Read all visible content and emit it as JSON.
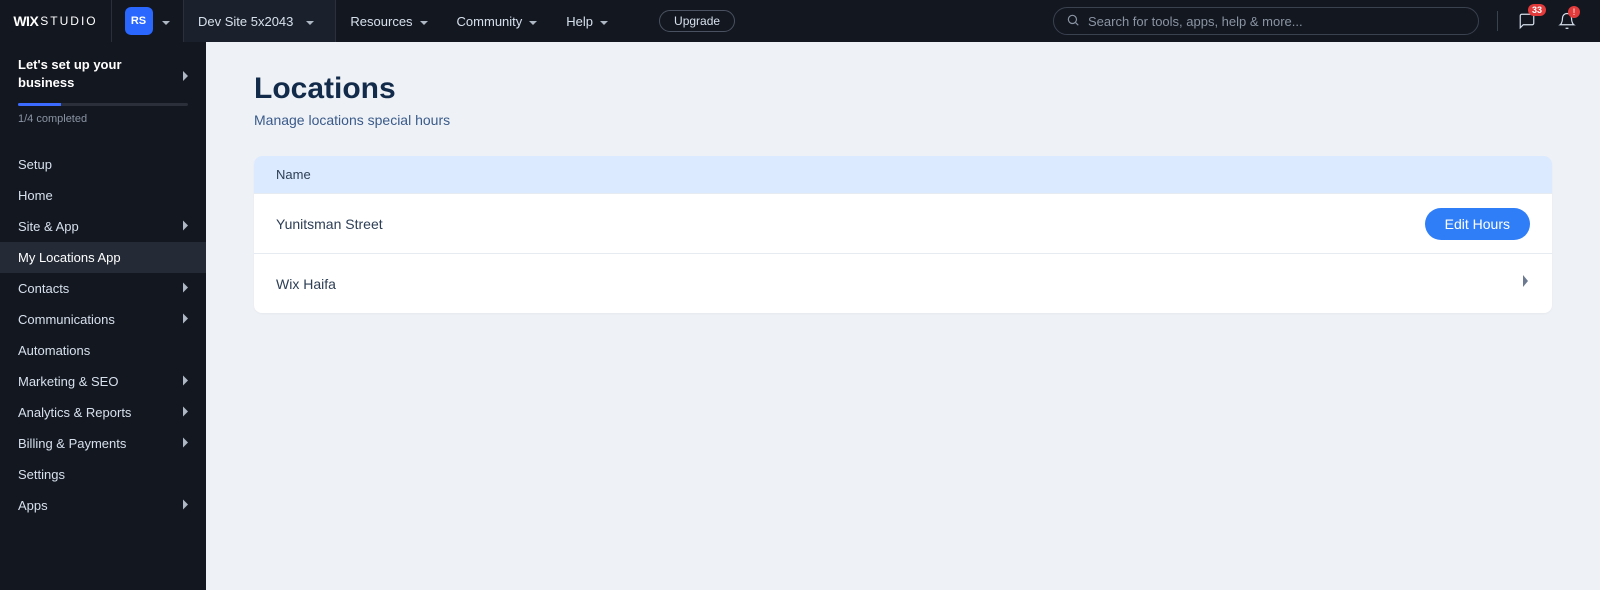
{
  "brand": {
    "wix": "WIX",
    "studio": "STUDIO"
  },
  "avatar": {
    "initials": "RS"
  },
  "site": {
    "name": "Dev Site 5x2043"
  },
  "topnav": {
    "resources": "Resources",
    "community": "Community",
    "help": "Help",
    "upgrade": "Upgrade"
  },
  "search": {
    "placeholder": "Search for tools, apps, help & more..."
  },
  "notifications": {
    "inbox_count": "33",
    "bell_alert": "!"
  },
  "setup": {
    "title_line1": "Let's set up your",
    "title_line2": "business",
    "progress_pct": 25,
    "progress_label": "1/4 completed"
  },
  "sidebar": {
    "setup_item": "Setup",
    "home": "Home",
    "site_app": "Site & App",
    "my_locations": "My Locations App",
    "contacts": "Contacts",
    "communications": "Communications",
    "automations": "Automations",
    "marketing": "Marketing & SEO",
    "analytics": "Analytics & Reports",
    "billing": "Billing & Payments",
    "settings": "Settings",
    "apps": "Apps"
  },
  "page": {
    "title": "Locations",
    "subtitle": "Manage locations special hours"
  },
  "table": {
    "header_name": "Name",
    "rows": [
      {
        "name": "Yunitsman Street",
        "edit_label": "Edit Hours",
        "show_edit": true
      },
      {
        "name": "Wix Haifa",
        "show_edit": false
      }
    ]
  }
}
